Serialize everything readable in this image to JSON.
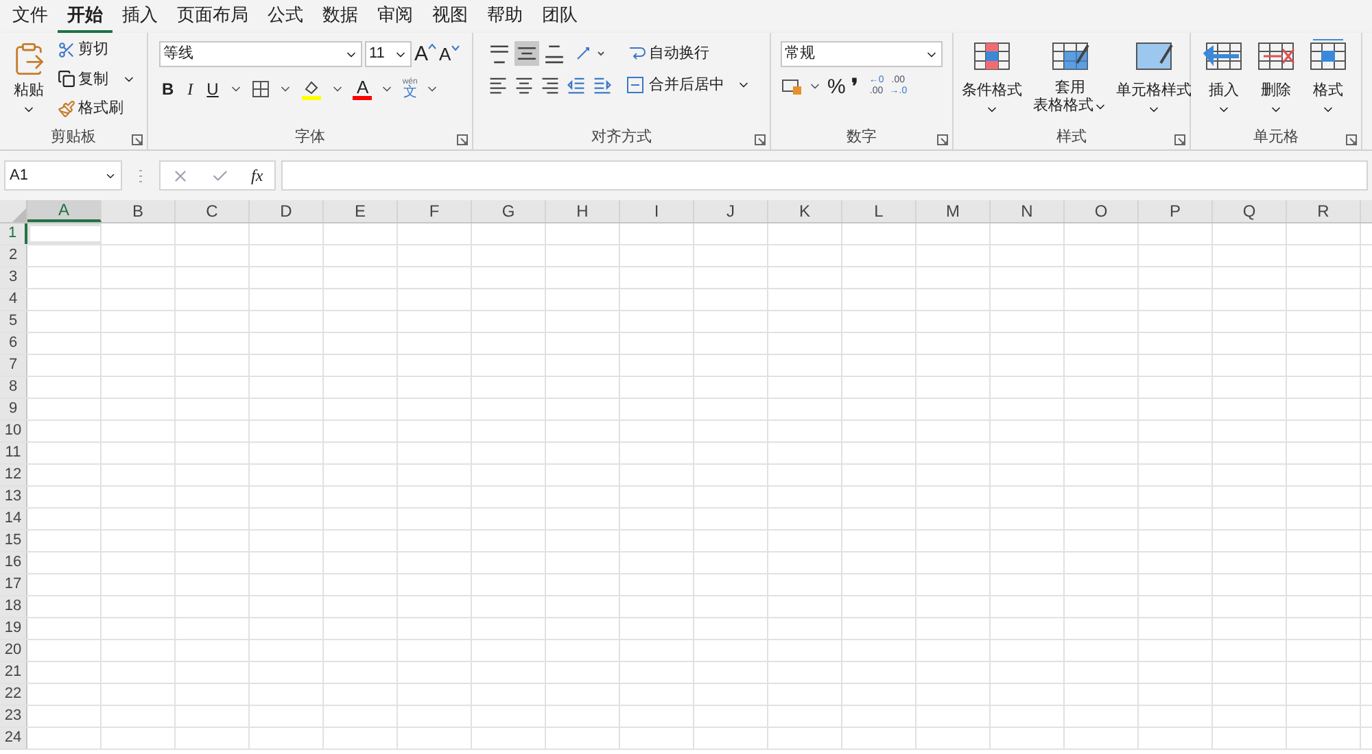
{
  "menu_tabs": [
    {
      "label": "文件",
      "selected": false
    },
    {
      "label": "开始",
      "selected": true
    },
    {
      "label": "插入",
      "selected": false
    },
    {
      "label": "页面布局",
      "selected": false
    },
    {
      "label": "公式",
      "selected": false
    },
    {
      "label": "数据",
      "selected": false
    },
    {
      "label": "审阅",
      "selected": false
    },
    {
      "label": "视图",
      "selected": false
    },
    {
      "label": "帮助",
      "selected": false
    },
    {
      "label": "团队",
      "selected": false
    }
  ],
  "clipboard": {
    "paste": "粘贴",
    "cut": "剪切",
    "copy": "复制",
    "format_painter": "格式刷",
    "label": "剪贴板"
  },
  "font": {
    "font_name": "等线",
    "font_size": "11",
    "grow": "A",
    "shrink": "A",
    "bold": "B",
    "italic": "I",
    "underline": "U",
    "font_color": "A",
    "phonetic_top": "wén",
    "phonetic_bottom": "文",
    "label": "字体"
  },
  "alignment": {
    "vertical": [
      {
        "selected": false
      },
      {
        "selected": true
      },
      {
        "selected": false
      }
    ],
    "wrap_text": "自动换行",
    "merge_center": "合并后居中",
    "label": "对齐方式"
  },
  "number": {
    "format": "常规",
    "percent": "%",
    "comma": "❜",
    "increase_decimal": [
      "←0",
      ".00"
    ],
    "decrease_decimal": [
      ".00",
      "→.0"
    ],
    "label": "数字"
  },
  "styles": {
    "conditional": "条件格式",
    "table_top": "套用",
    "table_bottom": "表格格式",
    "cell_styles": "单元格样式",
    "label": "样式"
  },
  "cells": {
    "insert": "插入",
    "delete": "删除",
    "format": "格式",
    "label": "单元格"
  },
  "formula_bar": {
    "name_box": "A1",
    "fx": "fx"
  },
  "columns": [
    {
      "label": "A",
      "selected": true
    },
    {
      "label": "B",
      "selected": false
    },
    {
      "label": "C",
      "selected": false
    },
    {
      "label": "D",
      "selected": false
    },
    {
      "label": "E",
      "selected": false
    },
    {
      "label": "F",
      "selected": false
    },
    {
      "label": "G",
      "selected": false
    },
    {
      "label": "H",
      "selected": false
    },
    {
      "label": "I",
      "selected": false
    },
    {
      "label": "J",
      "selected": false
    },
    {
      "label": "K",
      "selected": false
    },
    {
      "label": "L",
      "selected": false
    },
    {
      "label": "M",
      "selected": false
    },
    {
      "label": "N",
      "selected": false
    },
    {
      "label": "O",
      "selected": false
    },
    {
      "label": "P",
      "selected": false
    },
    {
      "label": "Q",
      "selected": false
    },
    {
      "label": "R",
      "selected": false
    }
  ],
  "rows": [
    {
      "label": "1",
      "selected": true
    },
    {
      "label": "2",
      "selected": false
    },
    {
      "label": "3",
      "selected": false
    },
    {
      "label": "4",
      "selected": false
    },
    {
      "label": "5",
      "selected": false
    },
    {
      "label": "6",
      "selected": false
    },
    {
      "label": "7",
      "selected": false
    },
    {
      "label": "8",
      "selected": false
    },
    {
      "label": "9",
      "selected": false
    },
    {
      "label": "10",
      "selected": false
    },
    {
      "label": "11",
      "selected": false
    },
    {
      "label": "12",
      "selected": false
    },
    {
      "label": "13",
      "selected": false
    },
    {
      "label": "14",
      "selected": false
    },
    {
      "label": "15",
      "selected": false
    },
    {
      "label": "16",
      "selected": false
    },
    {
      "label": "17",
      "selected": false
    },
    {
      "label": "18",
      "selected": false
    },
    {
      "label": "19",
      "selected": false
    },
    {
      "label": "20",
      "selected": false
    },
    {
      "label": "21",
      "selected": false
    },
    {
      "label": "22",
      "selected": false
    },
    {
      "label": "23",
      "selected": false
    },
    {
      "label": "24",
      "selected": false
    }
  ]
}
